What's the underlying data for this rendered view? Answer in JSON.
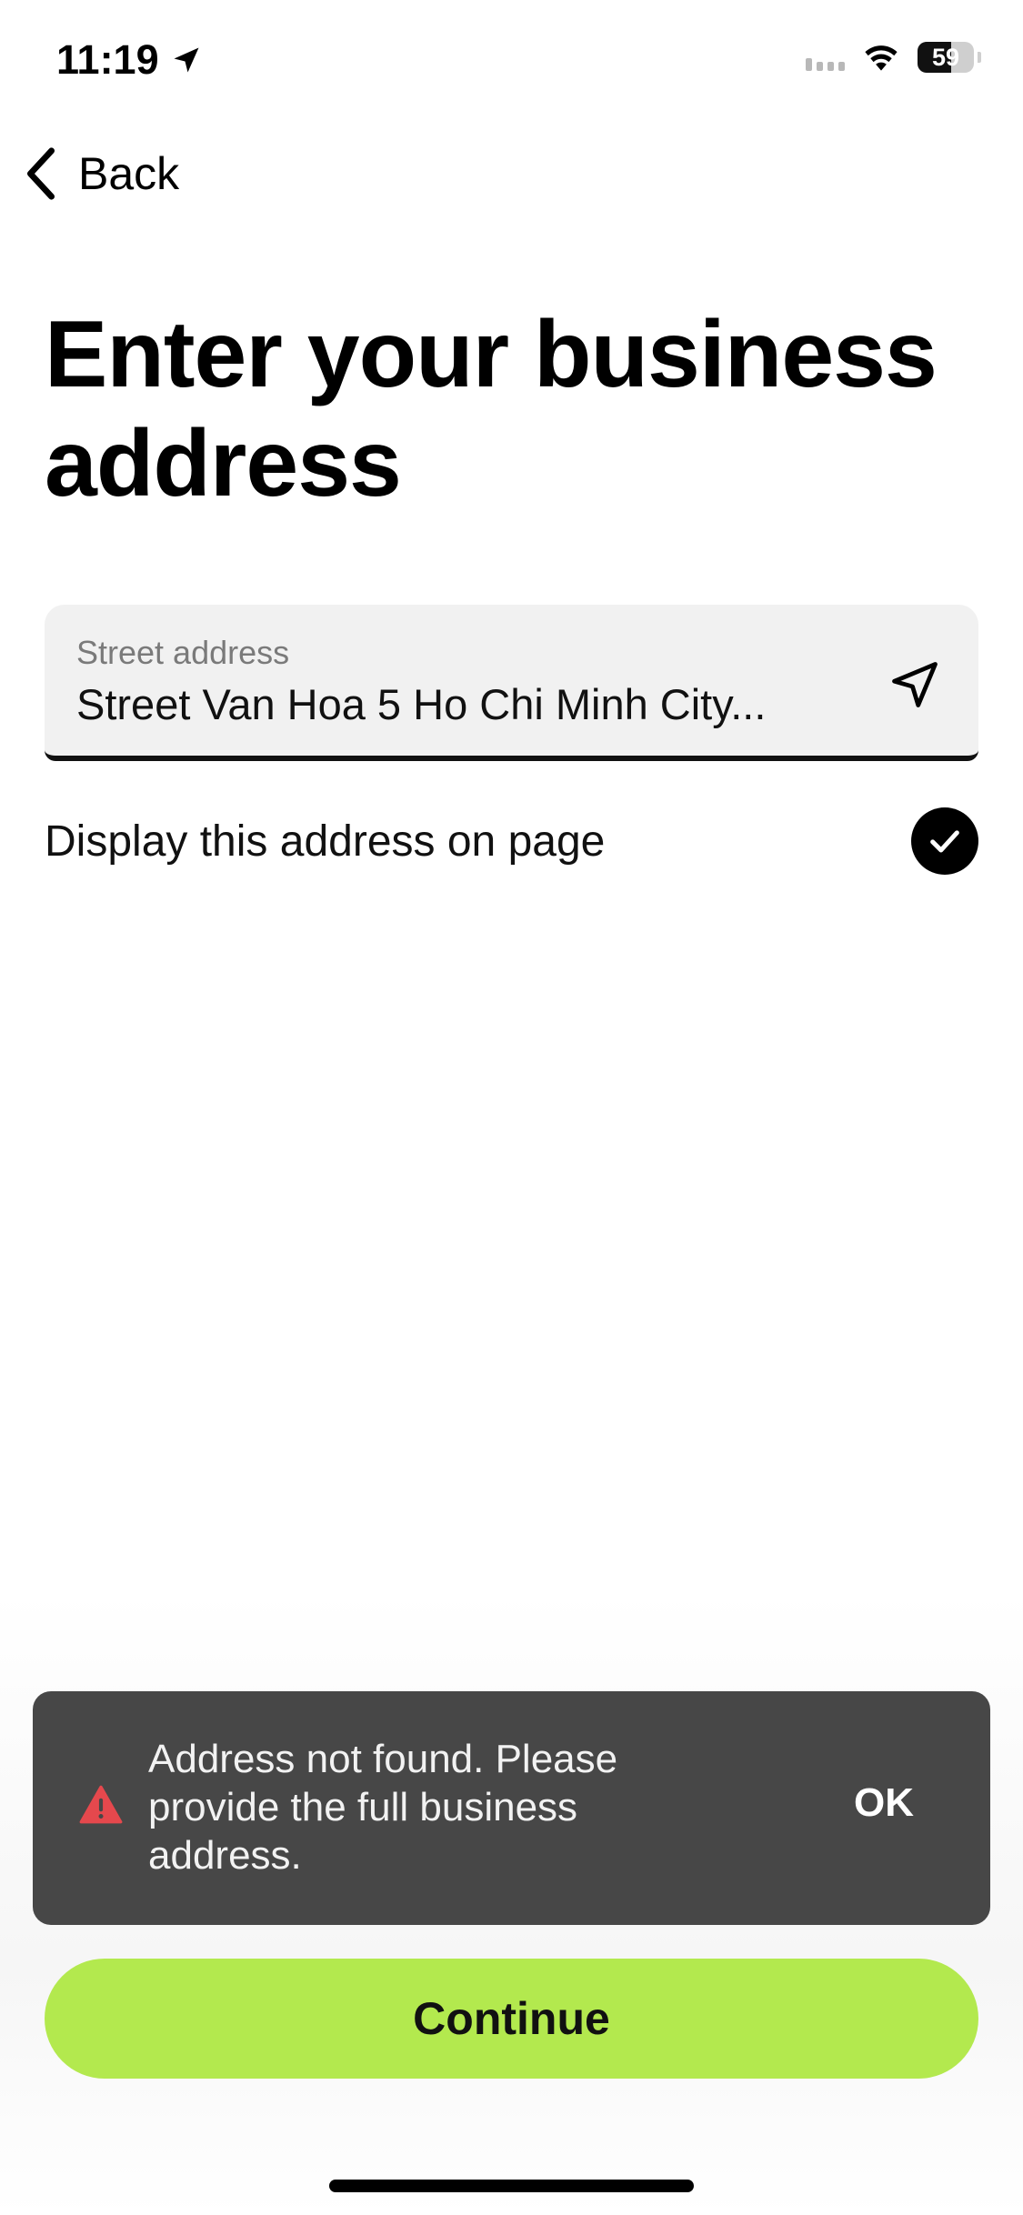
{
  "status_bar": {
    "time": "11:19",
    "battery": "59",
    "battery_level_percent": 59
  },
  "nav": {
    "back_label": "Back"
  },
  "page": {
    "title": "Enter your business address"
  },
  "address_field": {
    "label": "Street address",
    "value": "Street Van Hoa 5 Ho Chi Minh City..."
  },
  "display_option": {
    "label": "Display this address on page",
    "checked": true
  },
  "toast": {
    "message": "Address not found. Please provide the full business address.",
    "ok_label": "OK",
    "icon_color": "#e5484d"
  },
  "actions": {
    "continue_label": "Continue",
    "continue_color": "#b3e94e"
  }
}
